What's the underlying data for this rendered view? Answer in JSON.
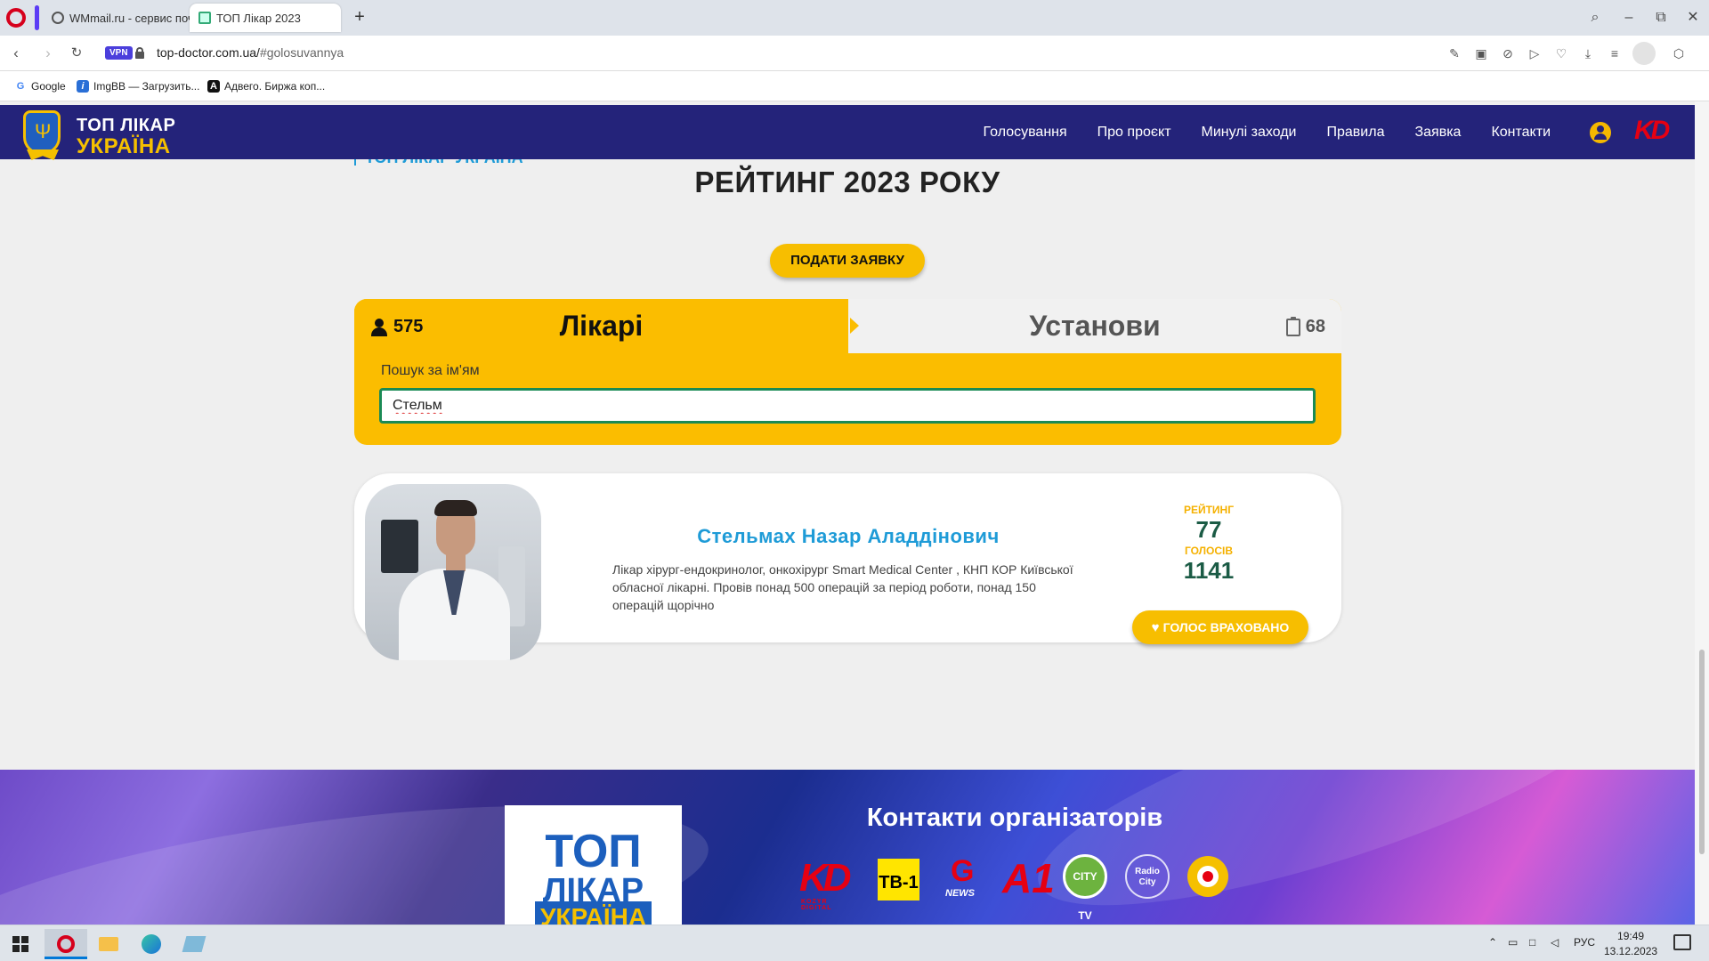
{
  "browser": {
    "tabs": [
      {
        "title": "WMmail.ru - сервис почт",
        "active": false
      },
      {
        "title": "ТОП Лікар 2023",
        "active": true
      }
    ],
    "new_tab_symbol": "+",
    "vpn_label": "VPN",
    "url_host": "top-doctor.com.ua/",
    "url_path": "#golosuvannya",
    "bookmarks": [
      {
        "label": "Google",
        "icon": "google-icon"
      },
      {
        "label": "ImgBB — Загрузить...",
        "icon": "imgbb-icon"
      },
      {
        "label": "Адвего. Биржа коп...",
        "icon": "advego-icon"
      }
    ]
  },
  "site": {
    "brand_line1": "ТОП ЛІКАР",
    "brand_line2": "УКРАЇНА",
    "menu": [
      "Голосування",
      "Про проєкт",
      "Минулі заходи",
      "Правила",
      "Заявка",
      "Контакти"
    ],
    "partner_logo": "KD",
    "breadcrumb_fragment": "ТОП ЛІКАР УКРАЇНА",
    "page_title": "РЕЙТИНГ 2023 РОКУ",
    "apply_button": "ПОДАТИ ЗАЯВКУ",
    "tabs": {
      "doctors_label": "Лікарі",
      "doctors_count": "575",
      "institutions_label": "Установи",
      "institutions_count": "68"
    },
    "search": {
      "label": "Пошук за ім'ям",
      "value": "Стельм"
    },
    "doctor": {
      "name": "Стельмах Назар Аладдінович",
      "description": "Лікар хірург-ендокринолог, онкохірург Smart Medical Center , КНП КОР Київської обласної лікарні. Провів понад 500 операцій за період роботи, понад 150 операцій щорічно",
      "rating_label": "РЕЙТИНГ",
      "rating_value": "77",
      "votes_label": "ГОЛОСІВ",
      "votes_value": "1141",
      "vote_button": "ГОЛОС ВРАХОВАНО"
    },
    "footer": {
      "logo_line1": "ТОП",
      "logo_line2": "ЛІКАР",
      "logo_line3": "УКРАЇНА",
      "contacts_title": "Контакти організаторів",
      "partners": [
        {
          "text": "KD",
          "subtext": "KOZYR DIGITAL"
        },
        {
          "text": "ТВ-1"
        },
        {
          "text": "G",
          "subtext": "NEWS"
        },
        {
          "text": "A1"
        },
        {
          "text": "CITY TV"
        },
        {
          "text": "Radio City"
        },
        {
          "text": ""
        }
      ]
    }
  },
  "taskbar": {
    "language": "РУС",
    "time": "19:49",
    "date": "13.12.2023"
  }
}
